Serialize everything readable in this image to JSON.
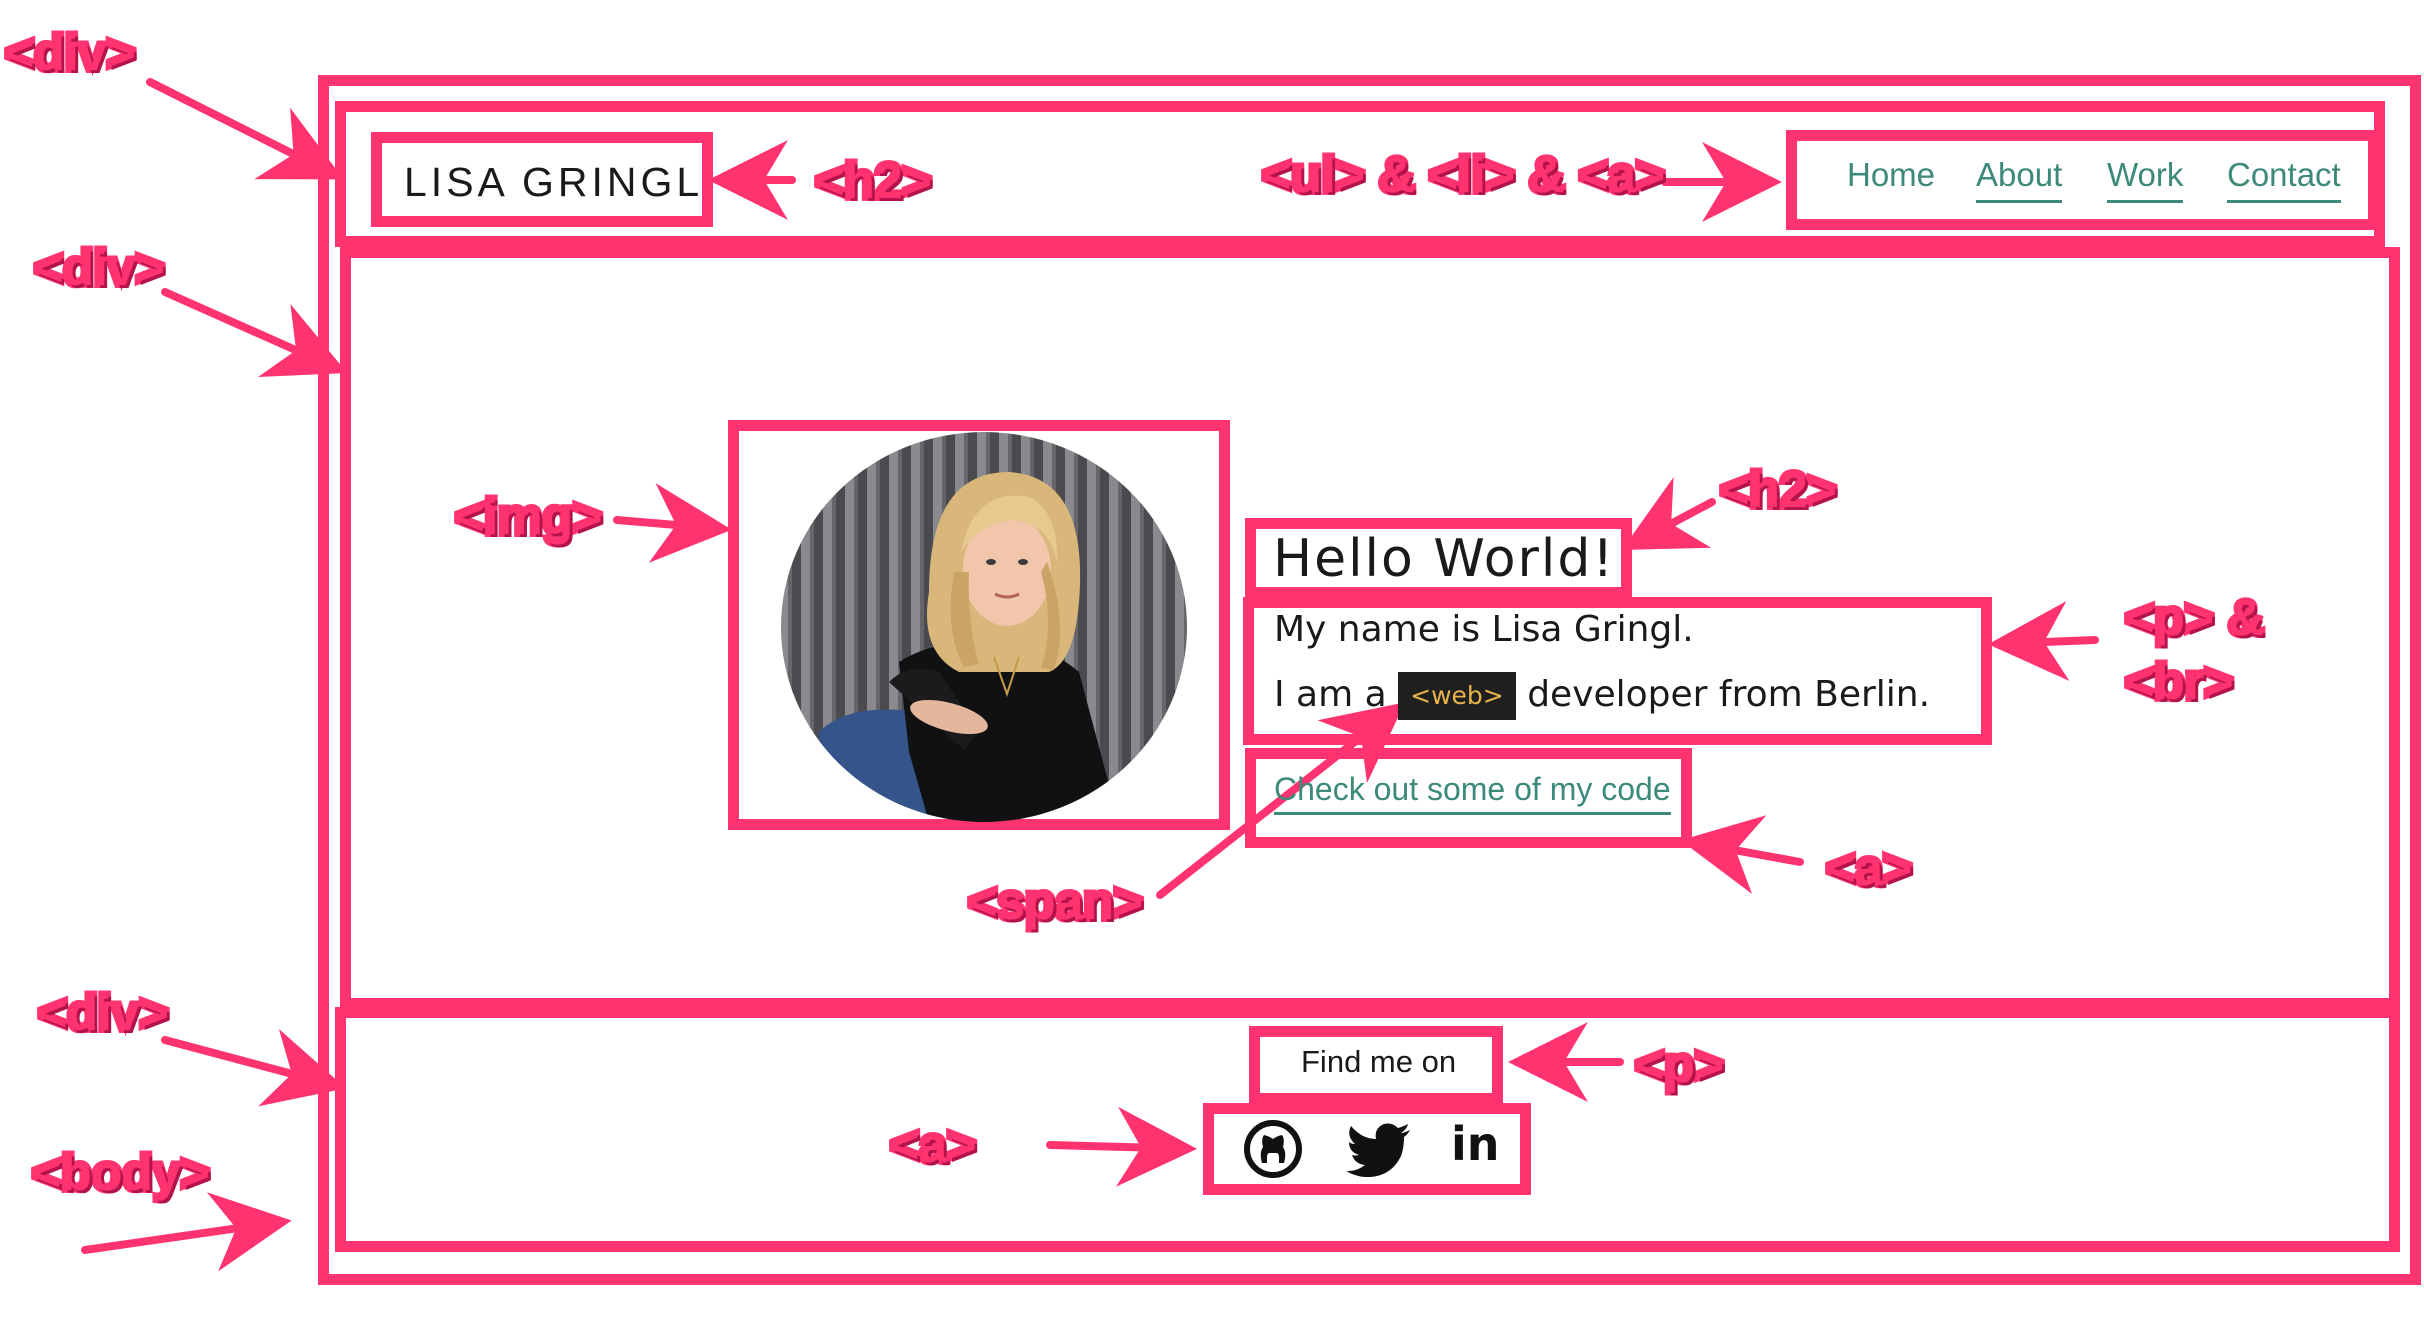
{
  "annotations": {
    "outer_div": "<div>",
    "header_h2": "<h2>",
    "nav_list": "<ul> & <li> & <a>",
    "main_div": "<div>",
    "img": "<img>",
    "hello_h2": "<h2>",
    "p_br_line1": "<p> &",
    "p_br_line2": "<br>",
    "span": "<span>",
    "code_a": "<a>",
    "footer_div": "<div>",
    "footer_p": "<p>",
    "footer_a": "<a>",
    "body": "<body>"
  },
  "header": {
    "brand": "LISA GRINGL",
    "nav": [
      "Home",
      "About",
      "Work",
      "Contact"
    ]
  },
  "hero": {
    "heading": "Hello World!",
    "line1": "My name is Lisa Gringl.",
    "line2_before": "I am a",
    "line2_span": "<web>",
    "line2_after": "developer from Berlin.",
    "link": "Check out some of my code"
  },
  "footer": {
    "text": "Find me on",
    "icons": [
      "github-icon",
      "twitter-icon",
      "linkedin-icon"
    ]
  },
  "colors": {
    "annotation": "#ff3370",
    "link": "#3d8a7a",
    "code_bg": "#1f1f1f",
    "code_text": "#e7b34a"
  }
}
